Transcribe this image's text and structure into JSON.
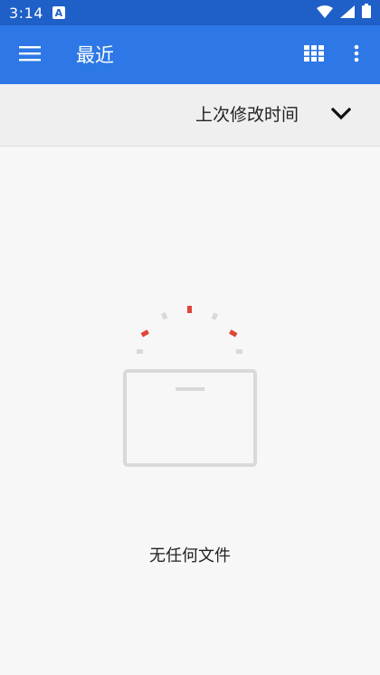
{
  "status_bar": {
    "time": "3:14",
    "notification_icon": "a-icon",
    "wifi_icon": "wifi-icon",
    "signal_icon": "signal-icon",
    "battery_icon": "battery-icon"
  },
  "app_bar": {
    "menu_icon": "menu-icon",
    "title": "最近",
    "grid_icon": "grid-view-icon",
    "more_icon": "more-vert-icon",
    "color": "#2d78e6"
  },
  "sort_bar": {
    "label": "上次修改时间",
    "chevron_icon": "chevron-down-icon"
  },
  "empty_state": {
    "illustration_icon": "empty-folder-icon",
    "message": "无任何文件",
    "accent_color": "#e0453a"
  }
}
